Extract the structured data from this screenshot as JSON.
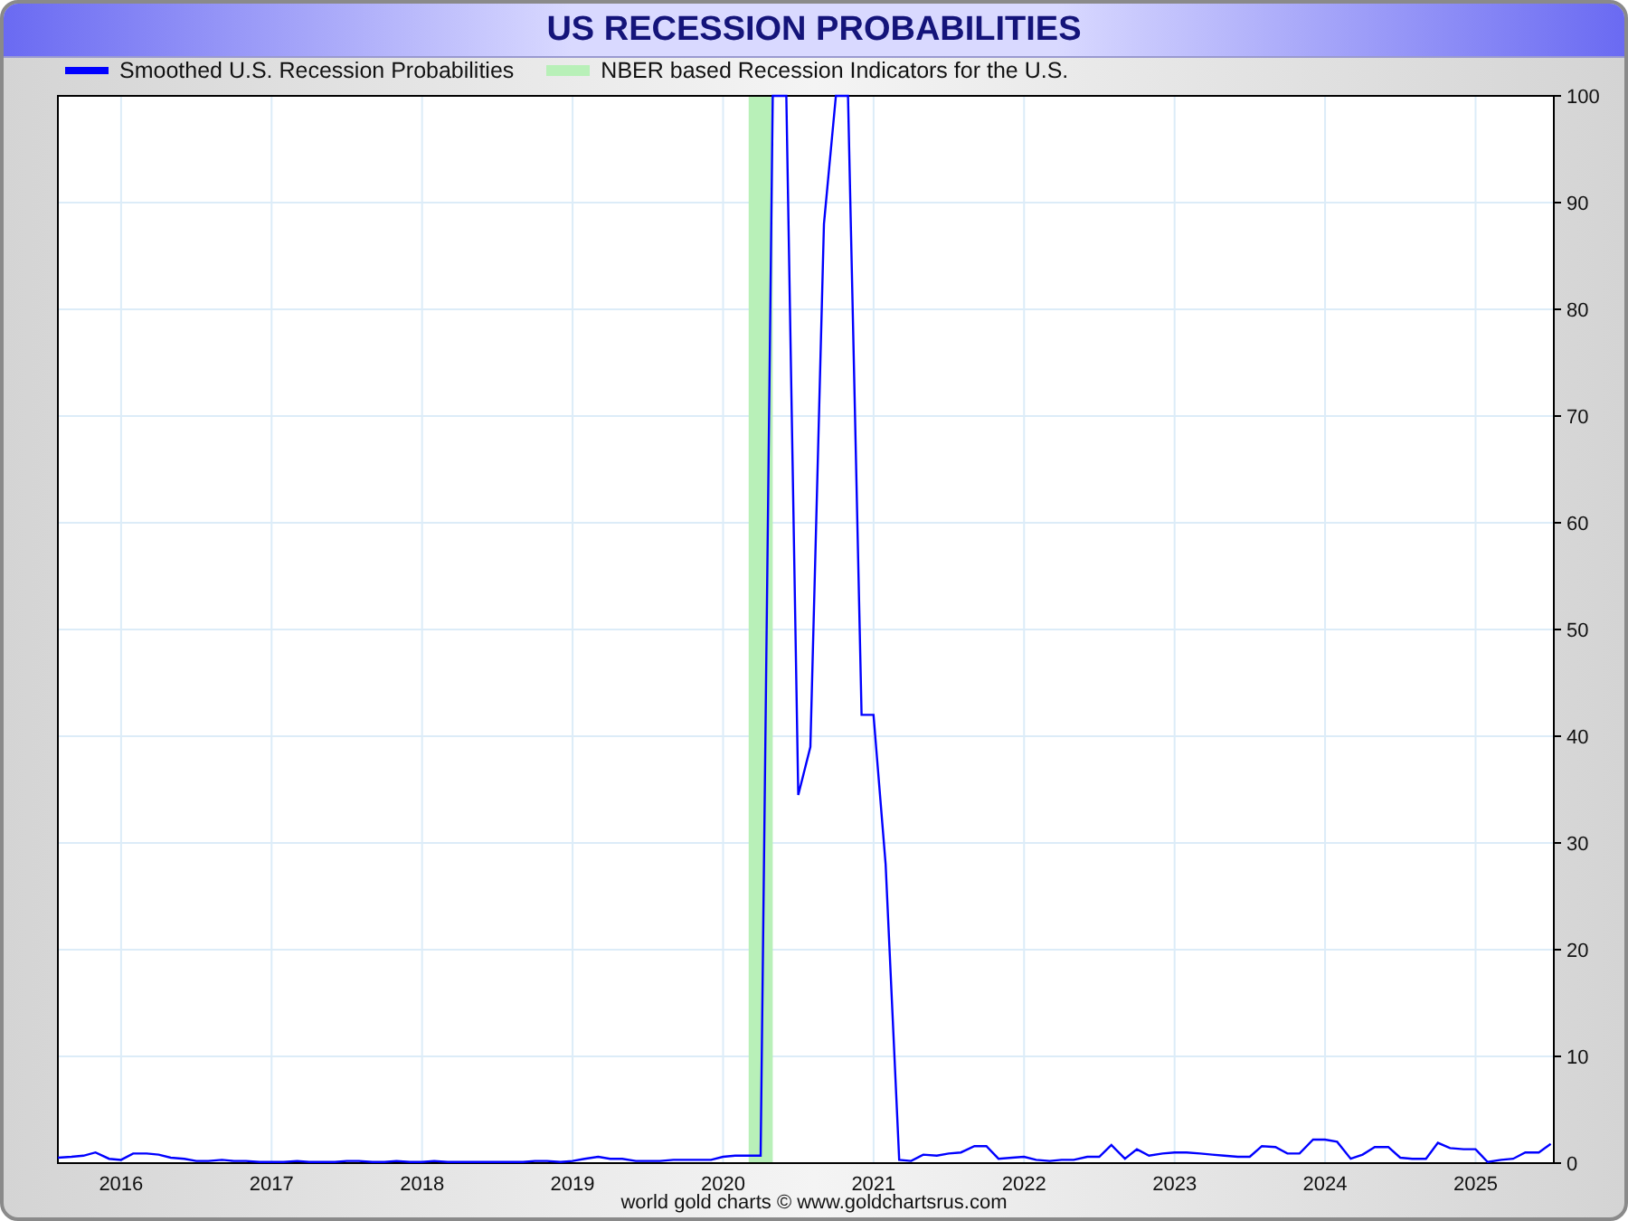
{
  "title": "US RECESSION PROBABILITIES",
  "chart_data": {
    "type": "line",
    "grid": true,
    "x": [
      2015.58,
      2015.67,
      2015.75,
      2015.83,
      2015.92,
      2016.0,
      2016.08,
      2016.17,
      2016.25,
      2016.33,
      2016.42,
      2016.5,
      2016.58,
      2016.67,
      2016.75,
      2016.83,
      2016.92,
      2017.0,
      2017.08,
      2017.17,
      2017.25,
      2017.33,
      2017.42,
      2017.5,
      2017.58,
      2017.67,
      2017.75,
      2017.83,
      2017.92,
      2018.0,
      2018.08,
      2018.17,
      2018.25,
      2018.33,
      2018.42,
      2018.5,
      2018.58,
      2018.67,
      2018.75,
      2018.83,
      2018.92,
      2019.0,
      2019.08,
      2019.17,
      2019.25,
      2019.33,
      2019.42,
      2019.5,
      2019.58,
      2019.67,
      2019.75,
      2019.83,
      2019.92,
      2020.0,
      2020.08,
      2020.17,
      2020.25,
      2020.33,
      2020.42,
      2020.5,
      2020.58,
      2020.67,
      2020.75,
      2020.83,
      2020.92,
      2021.0,
      2021.08,
      2021.17,
      2021.25,
      2021.33,
      2021.42,
      2021.5,
      2021.58,
      2021.67,
      2021.75,
      2021.83,
      2021.92,
      2022.0,
      2022.08,
      2022.17,
      2022.25,
      2022.33,
      2022.42,
      2022.5,
      2022.58,
      2022.67,
      2022.75,
      2022.83,
      2022.92,
      2023.0,
      2023.08,
      2023.17,
      2023.25,
      2023.33,
      2023.42,
      2023.5,
      2023.58,
      2023.67,
      2023.75,
      2023.83,
      2023.92,
      2024.0,
      2024.08,
      2024.17,
      2024.25,
      2024.33,
      2024.42,
      2024.5,
      2024.58,
      2024.67,
      2024.75,
      2024.83,
      2024.92,
      2025.0,
      2025.08,
      2025.17,
      2025.25,
      2025.33,
      2025.42,
      2025.5
    ],
    "series": [
      {
        "name": "Smoothed U.S. Recession Probabilities",
        "color": "#0000ff",
        "values": [
          0.5,
          0.6,
          0.7,
          1.0,
          0.4,
          0.3,
          0.9,
          0.9,
          0.8,
          0.5,
          0.4,
          0.2,
          0.2,
          0.3,
          0.2,
          0.2,
          0.1,
          0.1,
          0.1,
          0.2,
          0.1,
          0.1,
          0.1,
          0.2,
          0.2,
          0.1,
          0.1,
          0.2,
          0.1,
          0.1,
          0.2,
          0.1,
          0.1,
          0.1,
          0.1,
          0.1,
          0.1,
          0.1,
          0.2,
          0.2,
          0.1,
          0.2,
          0.4,
          0.6,
          0.4,
          0.4,
          0.2,
          0.2,
          0.2,
          0.3,
          0.3,
          0.3,
          0.3,
          0.6,
          0.7,
          0.7,
          0.7,
          100,
          100,
          34.5,
          39,
          88,
          100,
          100,
          42,
          42,
          28,
          0.3,
          0.2,
          0.8,
          0.7,
          0.9,
          1.0,
          1.6,
          1.6,
          0.4,
          0.5,
          0.6,
          0.3,
          0.2,
          0.3,
          0.3,
          0.6,
          0.6,
          1.7,
          0.4,
          1.3,
          0.7,
          0.9,
          1.0,
          1.0,
          0.9,
          0.8,
          0.7,
          0.6,
          0.6,
          1.6,
          1.5,
          0.9,
          0.9,
          2.2,
          2.2,
          2.0,
          0.4,
          0.8,
          1.5,
          1.5,
          0.5,
          0.4,
          0.4,
          1.9,
          1.4,
          1.3,
          1.3,
          0.1,
          0.3,
          0.4,
          1.0,
          1.0,
          1.8
        ]
      }
    ],
    "bands": [
      {
        "label": "NBER based Recession Indicators for the U.S.",
        "color": "#b8f0b8",
        "axis": "x",
        "from": 2020.17,
        "to": 2020.33
      }
    ],
    "xlim": [
      2015.58,
      2025.52
    ],
    "ylim": [
      0,
      100
    ],
    "xticks": [
      2016,
      2017,
      2018,
      2019,
      2020,
      2021,
      2022,
      2023,
      2024,
      2025
    ],
    "yticks": [
      0,
      10,
      20,
      30,
      40,
      50,
      60,
      70,
      80,
      90,
      100
    ]
  },
  "footer": "world gold charts © www.goldchartsrus.com"
}
